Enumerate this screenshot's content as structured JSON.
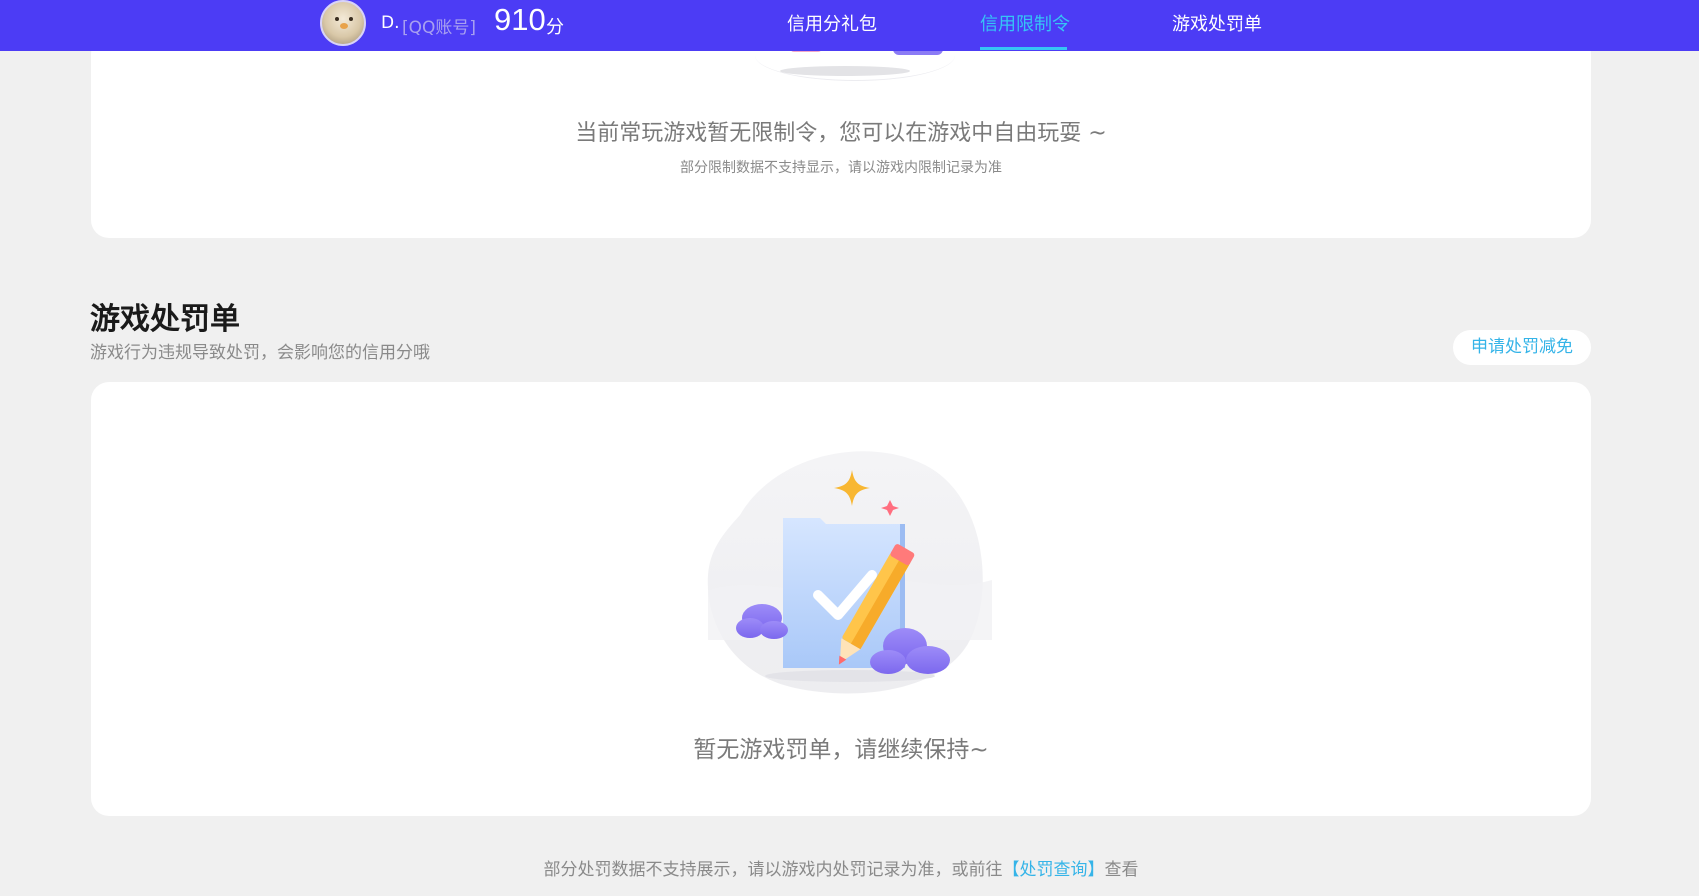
{
  "header": {
    "user_name": "D.",
    "account_tag": "[QQ账号]",
    "score": "910",
    "score_unit": "分",
    "tabs": [
      {
        "label": "信用分礼包",
        "active": false
      },
      {
        "label": "信用限制令",
        "active": true
      },
      {
        "label": "游戏处罚单",
        "active": false
      }
    ],
    "colors": {
      "bar": "#4c3cf5",
      "active_tab": "#35c5f5"
    }
  },
  "restriction_card": {
    "message": "当前常玩游戏暂无限制令，您可以在游戏中自由玩耍 ~",
    "note": "部分限制数据不支持显示，请以游戏内限制记录为准"
  },
  "penalty_section": {
    "title": "游戏处罚单",
    "description": "游戏行为违规导致处罚，会影响您的信用分哦",
    "appeal_button": "申请处罚减免",
    "empty_message": "暂无游戏罚单，请继续保持~"
  },
  "footer": {
    "note_prefix": "部分处罚数据不支持展示，请以游戏内处罚记录为准，或前往",
    "link_label": "【处罚查询】",
    "note_suffix": "查看"
  },
  "icons": [
    "avatar",
    "empty-penalty-illustration",
    "restriction-illustration"
  ]
}
